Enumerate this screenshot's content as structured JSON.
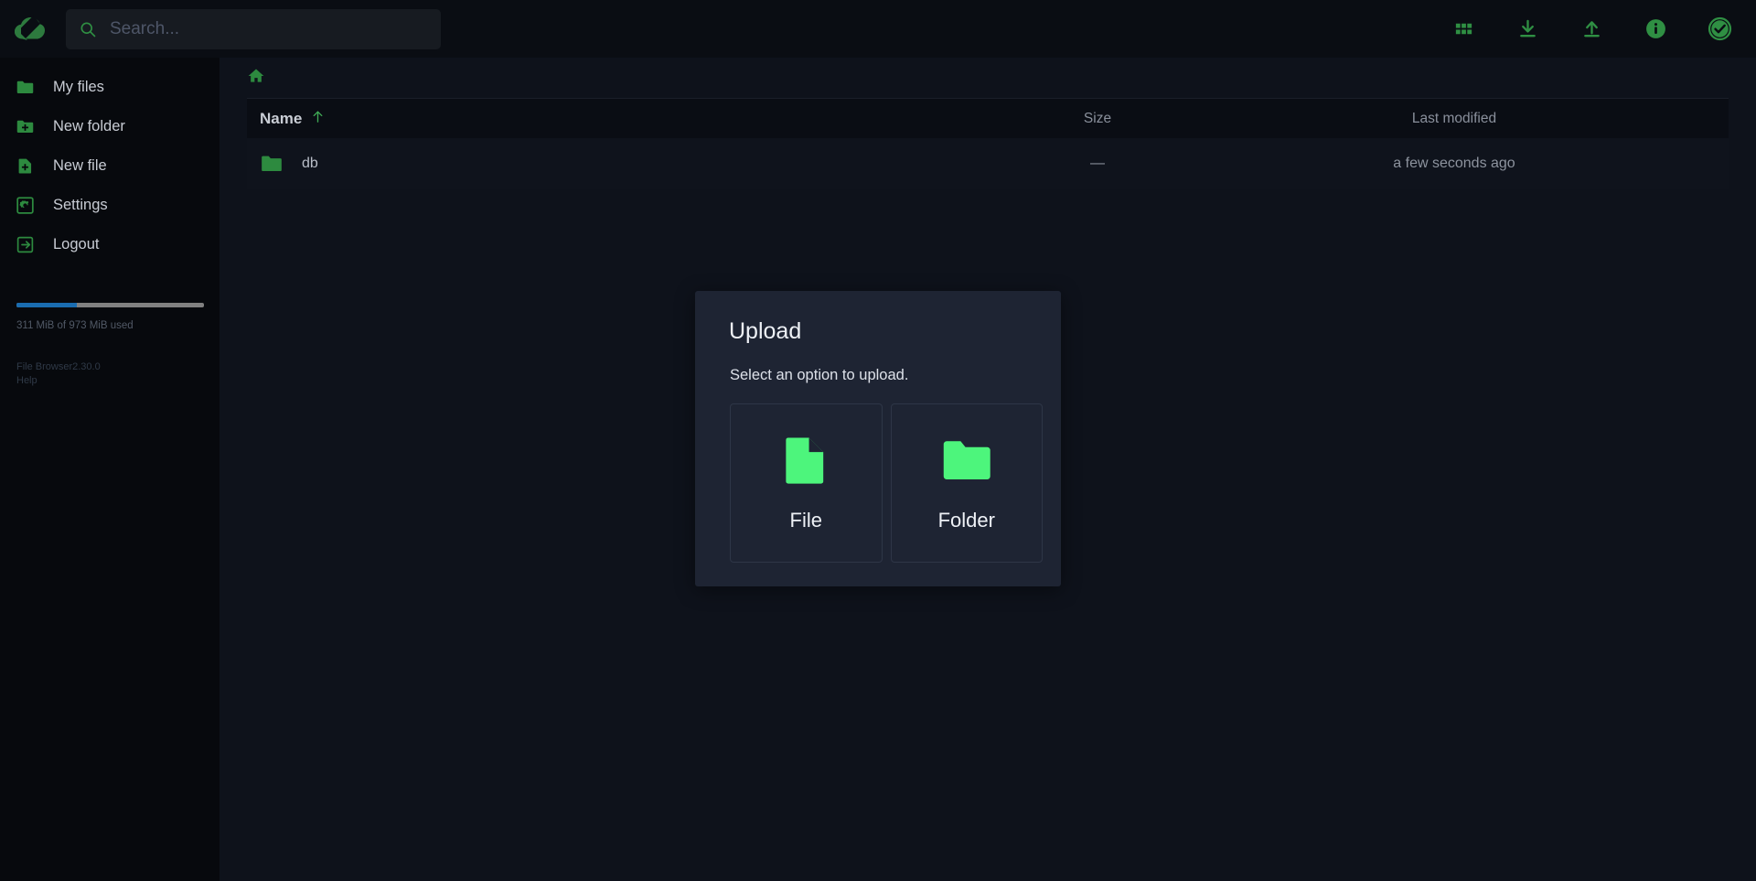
{
  "app": {
    "name": "File Browser",
    "version": "2.30.0",
    "accent_green": "#4df57c",
    "icon_green": "#2f8f43",
    "sidebar_bg": "#07090d",
    "main_bg": "#0e121b",
    "modal_bg": "#1e2433",
    "progress_fill": "#1a6cb0",
    "progress_track": "#808080"
  },
  "header": {
    "logo_icon": "cloud-k-logo-icon",
    "search": {
      "placeholder": "Search...",
      "value": "",
      "icon": "search-icon"
    },
    "actions": [
      {
        "name": "grid-view-button",
        "icon": "grid-icon",
        "label": "Switch view"
      },
      {
        "name": "download-button",
        "icon": "download-icon",
        "label": "Download"
      },
      {
        "name": "upload-button",
        "icon": "upload-icon",
        "label": "Upload"
      },
      {
        "name": "info-button",
        "icon": "info-circle-icon",
        "label": "Info"
      },
      {
        "name": "select-all-button",
        "icon": "check-circle-icon",
        "label": "Select multiple"
      }
    ]
  },
  "sidebar": {
    "items": [
      {
        "label": "My files",
        "icon": "folder-icon"
      },
      {
        "label": "New folder",
        "icon": "folder-plus-icon"
      },
      {
        "label": "New file",
        "icon": "file-plus-icon"
      },
      {
        "label": "Settings",
        "icon": "gear-icon"
      },
      {
        "label": "Logout",
        "icon": "logout-icon"
      }
    ],
    "usage": {
      "text": "311 MiB of 973 MiB used",
      "percent": 32,
      "used": "311 MiB",
      "total": "973 MiB"
    },
    "footer": {
      "product_line": "File Browser2.30.0",
      "help_label": "Help"
    }
  },
  "main": {
    "breadcrumb": {
      "home_icon": "home-icon",
      "path": "/"
    },
    "table": {
      "columns": [
        {
          "key": "name",
          "label": "Name",
          "sorted": true,
          "sort_icon": "arrow-up-icon"
        },
        {
          "key": "size",
          "label": "Size",
          "sorted": false
        },
        {
          "key": "modified",
          "label": "Last modified",
          "sorted": false
        }
      ],
      "rows": [
        {
          "icon": "folder-icon",
          "name": "db",
          "size": "—",
          "modified": "a few seconds ago"
        }
      ]
    }
  },
  "modal": {
    "title": "Upload",
    "subtitle": "Select an option to upload.",
    "options": [
      {
        "label": "File",
        "icon": "file-icon"
      },
      {
        "label": "Folder",
        "icon": "folder-icon"
      }
    ]
  }
}
